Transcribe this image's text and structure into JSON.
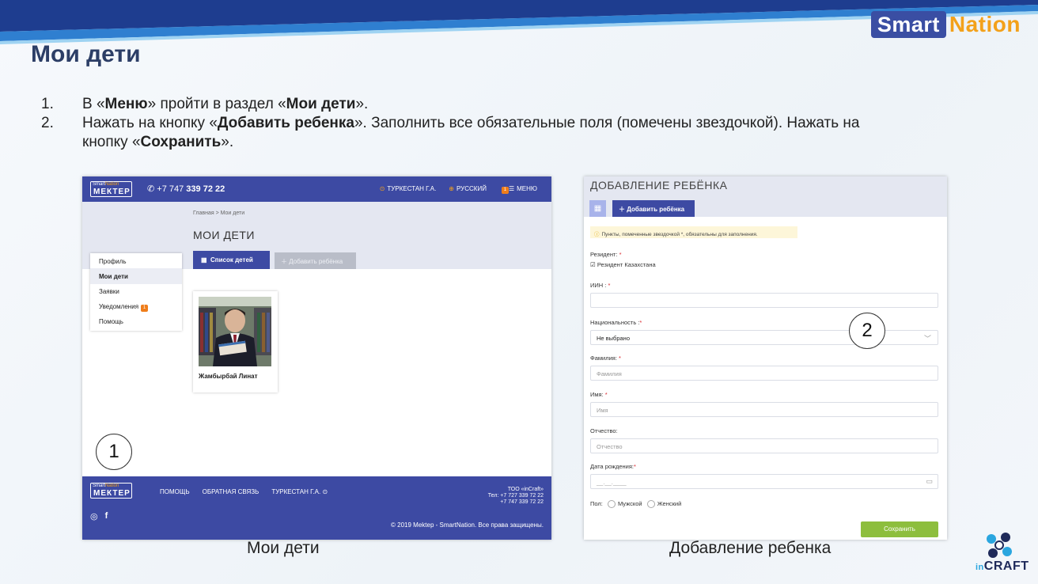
{
  "brand": {
    "smart": "Smart",
    "nation": "Nation"
  },
  "title": "Мои дети",
  "steps": [
    {
      "num": "1.",
      "parts": [
        "В «",
        "Меню",
        "» пройти в раздел «",
        "Мои дети",
        "»."
      ]
    },
    {
      "num": "2.",
      "parts": [
        "Нажать на кнопку «",
        "Добавить ребенка",
        "». Заполнить все обязательные поля (помечены звездочкой). Нажать на кнопку «",
        "Сохранить",
        "»."
      ]
    }
  ],
  "shot1": {
    "logo_small": "Smart",
    "logo_small_n": "Nation",
    "logo_main": "МЕКТЕР",
    "phone_prefix": "+7 747",
    "phone_main": "339 72 22",
    "nav": [
      "ТУРКЕСТАН Г.А.",
      "РУССКИЙ",
      "МЕНЮ"
    ],
    "nav_badge": "1",
    "breadcrumb": "Главная  >  Мои дети",
    "page_title": "МОИ ДЕТИ",
    "tab_list": "Список детей",
    "tab_add": "Добавить ребёнка",
    "menu": [
      "Профиль",
      "Мои дети",
      "Заявки",
      "Уведомления",
      "Помощь"
    ],
    "notif_badge": "1",
    "child_name": "Жамбырбай Линат",
    "footer_links": [
      "ПОМОЩЬ",
      "ОБРАТНАЯ СВЯЗЬ",
      "ТУРКЕСТАН Г.А."
    ],
    "footer_company": "ТОО «inCraft»",
    "footer_tel1": "Тел: +7 727 339 72 22",
    "footer_tel2": "+7 747 339 72 22",
    "footer_copy": "© 2019 Mektep - SmartNation. Все права защищены.",
    "marker": "1"
  },
  "shot2": {
    "title": "ДОБАВЛЕНИЕ РЕБЁНКА",
    "tab_add": "Добавить ребёнка",
    "notice": "Пункты, помеченные звездочкой *, обязательны для заполнения.",
    "resident_label": "Резидент:",
    "resident_check": "Резидент Казахстана",
    "iin_label": "ИИН :",
    "nationality_label": "Национальность :",
    "nationality_value": "Не выбрано",
    "surname_label": "Фамилия:",
    "surname_ph": "Фамилия",
    "name_label": "Имя:",
    "name_ph": "Имя",
    "patronymic_label": "Отчество:",
    "patronymic_ph": "Отчество",
    "birth_label": "Дата рождения:",
    "birth_ph": "__.__.____",
    "gender_label": "Пол:",
    "gender_male": "Мужской",
    "gender_female": "Женский",
    "save": "Сохранить",
    "star": "*",
    "marker": "2"
  },
  "captions": [
    "Мои дети",
    "Добавление ребенка"
  ],
  "incraft": {
    "in": "in",
    "craft": "CRAFT"
  }
}
